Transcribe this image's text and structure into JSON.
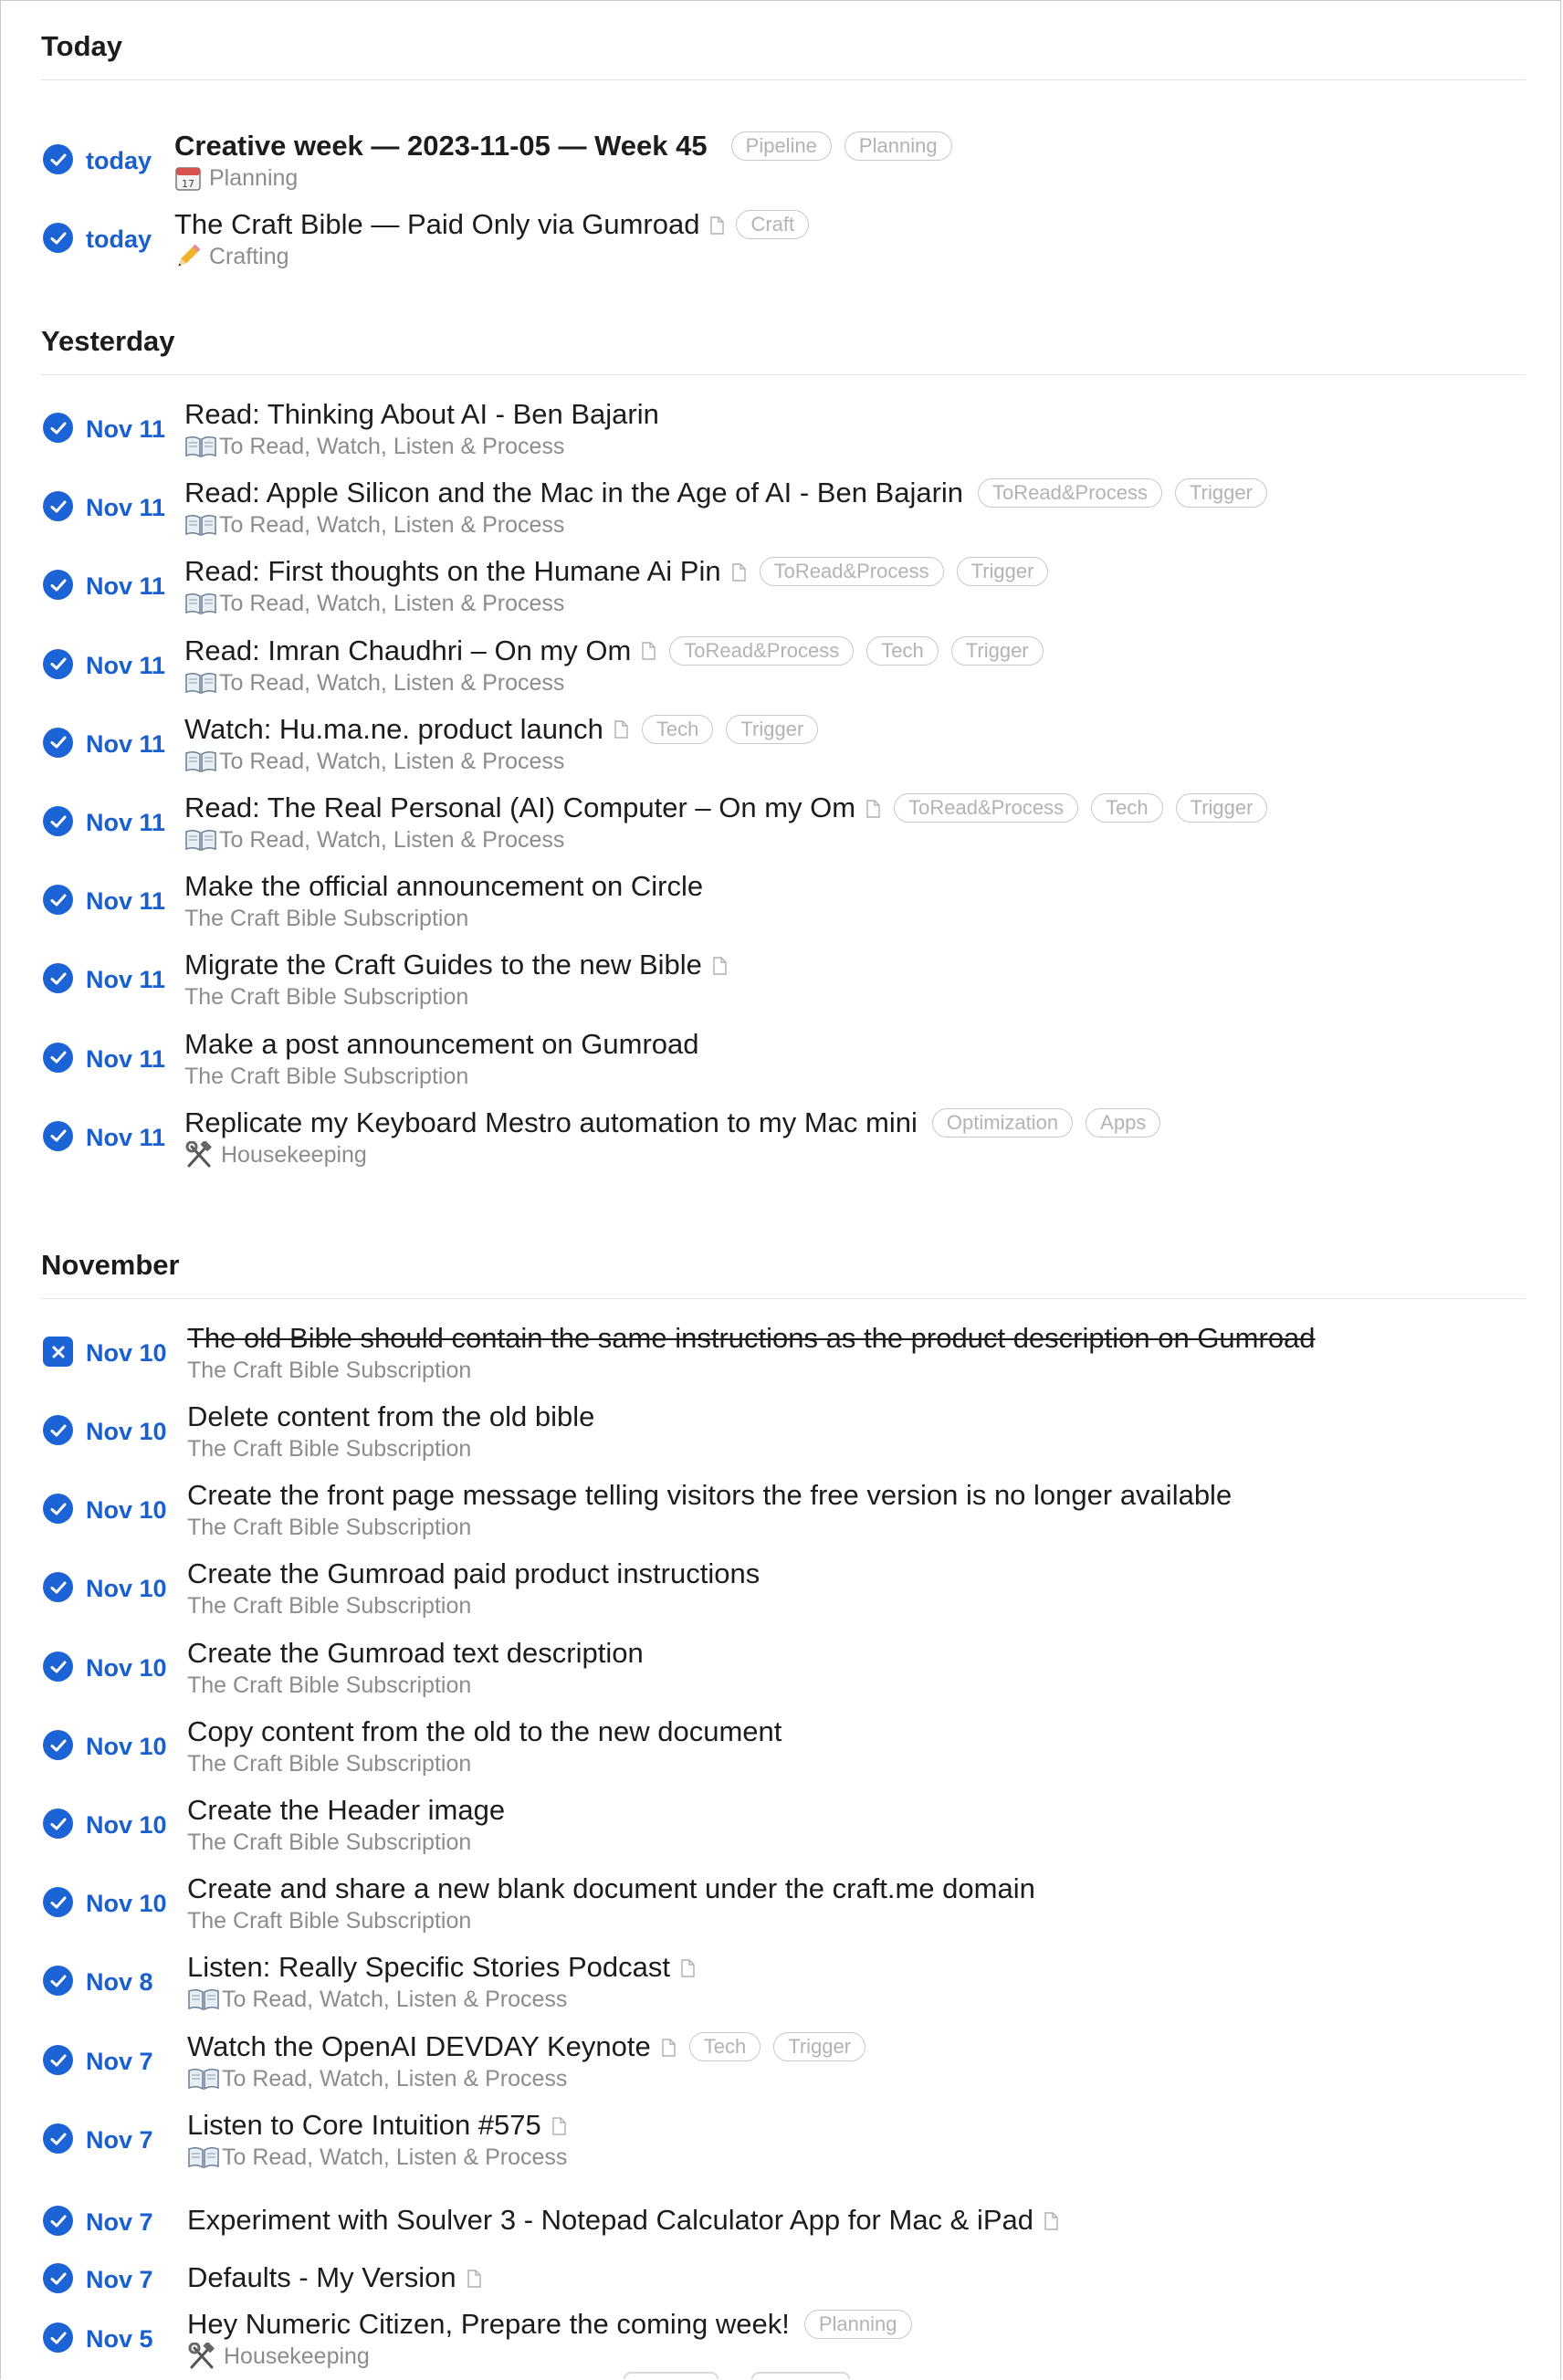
{
  "sections": {
    "today": "Today",
    "yesterday": "Yesterday",
    "november": "November"
  },
  "projects": {
    "planning": "Planning",
    "crafting": "Crafting",
    "to_read": "To Read, Watch, Listen & Process",
    "bible_sub": "The Craft Bible Subscription",
    "housekeeping": "Housekeeping"
  },
  "tags": {
    "pipeline": "Pipeline",
    "planning": "Planning",
    "craft": "Craft",
    "toread": "ToRead&Process",
    "trigger": "Trigger",
    "tech": "Tech",
    "optimization": "Optimization",
    "apps": "Apps"
  },
  "today": [
    {
      "date": "today",
      "title": "Creative week — 2023-11-05 — Week 45"
    },
    {
      "date": "today",
      "title": "The Craft Bible — Paid Only via Gumroad"
    }
  ],
  "yesterday": [
    {
      "date": "Nov 11",
      "title": "Read: Thinking About AI - Ben Bajarin"
    },
    {
      "date": "Nov 11",
      "title": "Read: Apple Silicon and the Mac in the Age of AI - Ben Bajarin"
    },
    {
      "date": "Nov 11",
      "title": "Read: First thoughts on the Humane Ai Pin"
    },
    {
      "date": "Nov 11",
      "title": "Read: Imran Chaudhri – On my Om"
    },
    {
      "date": "Nov 11",
      "title": "Watch: Hu.ma.ne. product launch"
    },
    {
      "date": "Nov 11",
      "title": "Read: The Real Personal (AI) Computer – On my Om"
    },
    {
      "date": "Nov 11",
      "title": "Make the official announcement on Circle"
    },
    {
      "date": "Nov 11",
      "title": "Migrate the Craft Guides to the new Bible"
    },
    {
      "date": "Nov 11",
      "title": "Make a post announcement on Gumroad"
    },
    {
      "date": "Nov 11",
      "title": "Replicate my Keyboard Mestro automation to my Mac mini"
    }
  ],
  "november": [
    {
      "date": "Nov 10",
      "title": "The old Bible should contain the same instructions as the product description on Gumroad"
    },
    {
      "date": "Nov 10",
      "title": "Delete content from the old bible"
    },
    {
      "date": "Nov 10",
      "title": "Create the front page message telling visitors the free version is no longer available"
    },
    {
      "date": "Nov 10",
      "title": "Create the Gumroad paid product instructions"
    },
    {
      "date": "Nov 10",
      "title": "Create the Gumroad text description"
    },
    {
      "date": "Nov 10",
      "title": "Copy content from the old to the new document"
    },
    {
      "date": "Nov 10",
      "title": "Create the Header image"
    },
    {
      "date": "Nov 10",
      "title": "Create and share a new blank document under the craft.me domain"
    },
    {
      "date": "Nov 8",
      "title": "Listen: Really Specific Stories Podcast"
    },
    {
      "date": "Nov 7",
      "title": "Watch the OpenAI DEVDAY Keynote"
    },
    {
      "date": "Nov 7",
      "title": "Listen to Core Intuition #575"
    },
    {
      "date": "Nov 7",
      "title": "Experiment with Soulver 3 - Notepad Calculator App for Mac & iPad"
    },
    {
      "date": "Nov 7",
      "title": "Defaults - My Version"
    },
    {
      "date": "Nov 5",
      "title": "Hey Numeric Citizen, Prepare the coming week!"
    }
  ],
  "colors": {
    "accent": "#1c63d6",
    "date": "#1a5fd0",
    "tag_border": "#c8c8c8",
    "subtitle": "#8c8c8c"
  },
  "icons": {
    "check": "checkmark-icon",
    "cancel": "x-mark-icon",
    "doc": "document-icon",
    "calendar": "calendar-icon",
    "pencil": "pencil-icon",
    "book": "open-book-icon",
    "tools": "hammer-wrench-icon"
  }
}
